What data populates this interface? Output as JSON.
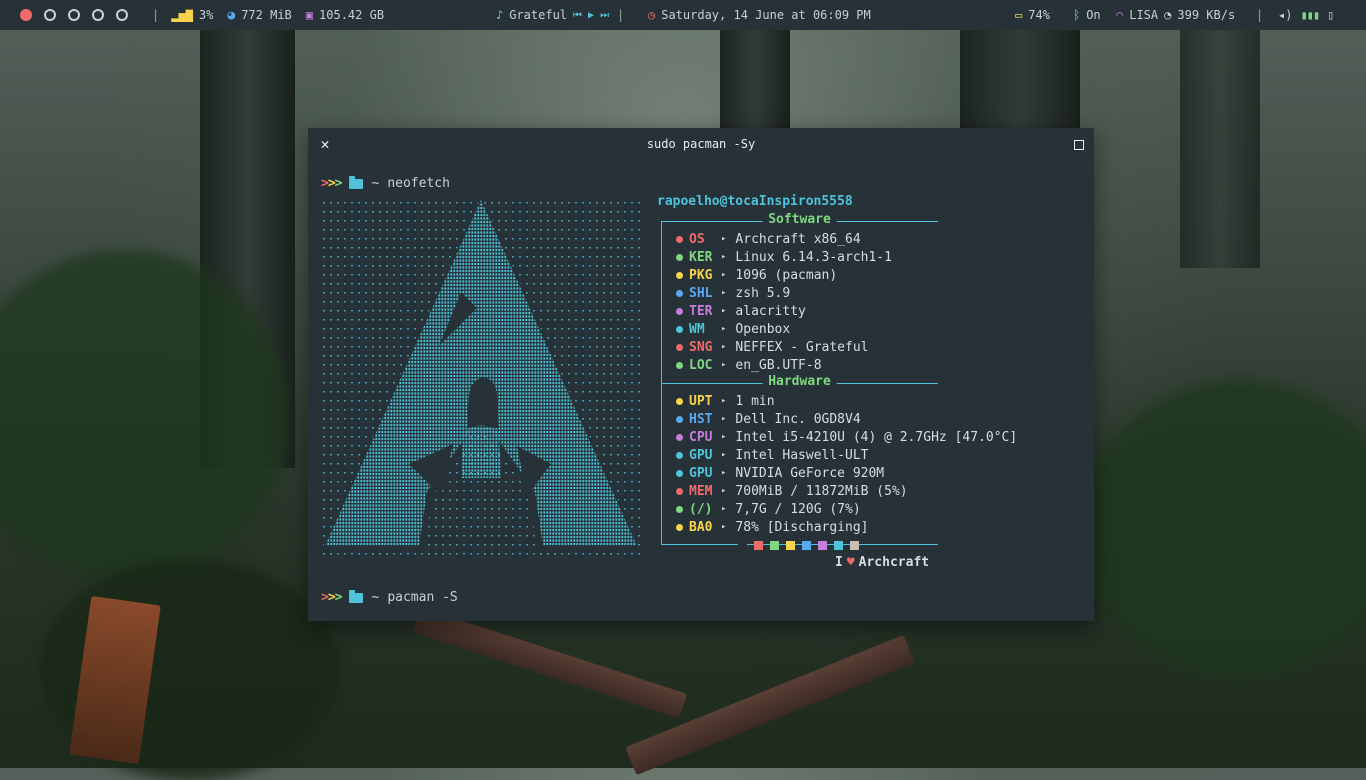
{
  "topbar": {
    "workspaces": [
      {
        "active": true
      },
      {
        "active": false
      },
      {
        "active": false
      },
      {
        "active": false
      },
      {
        "active": false
      }
    ],
    "cpu": "3%",
    "mem": "772 MiB",
    "disk": "105.42 GB",
    "song": "Grateful",
    "datetime": "Saturday, 14 June at 06:09 PM",
    "battery": "74%",
    "bluetooth": "On",
    "wifi_name": "LISA",
    "net_speed": "399 KB/s"
  },
  "terminal": {
    "title": "sudo pacman -Sy",
    "prompt1": {
      "arrows": ">>>",
      "cwd": "~",
      "command": "neofetch"
    },
    "prompt2": {
      "arrows": ">>>",
      "cwd": "~",
      "command": "pacman -S"
    },
    "user_host": "rapoelho@tocaInspiron5558",
    "software_title": "Software",
    "hardware_title": "Hardware",
    "software": [
      {
        "key": "OS",
        "value": "Archcraft x86_64",
        "color": "#ef6b6b"
      },
      {
        "key": "KER",
        "value": "Linux 6.14.3-arch1-1",
        "color": "#7fd87f"
      },
      {
        "key": "PKG",
        "value": "1096 (pacman)",
        "color": "#f7d44c"
      },
      {
        "key": "SHL",
        "value": "zsh 5.9",
        "color": "#5aa9f0"
      },
      {
        "key": "TER",
        "value": "alacritty",
        "color": "#c77ddb"
      },
      {
        "key": "WM",
        "value": "Openbox",
        "color": "#4fc3d9"
      },
      {
        "key": "SNG",
        "value": "NEFFEX - Grateful",
        "color": "#ef6b6b"
      },
      {
        "key": "LOC",
        "value": "en_GB.UTF-8",
        "color": "#7fd87f"
      }
    ],
    "hardware": [
      {
        "key": "UPT",
        "value": "1 min",
        "color": "#f7d44c"
      },
      {
        "key": "HST",
        "value": "Dell Inc. 0GD8V4",
        "color": "#5aa9f0"
      },
      {
        "key": "CPU",
        "value": "Intel i5-4210U (4) @ 2.7GHz [47.0°C]",
        "color": "#c77ddb"
      },
      {
        "key": "GPU",
        "value": "Intel Haswell-ULT",
        "color": "#4fc3d9"
      },
      {
        "key": "GPU",
        "value": "NVIDIA GeForce 920M",
        "color": "#4fc3d9"
      },
      {
        "key": "MEM",
        "value": "700MiB / 11872MiB (5%)",
        "color": "#ef6b6b"
      },
      {
        "key": "(/)",
        "value": "7,7G / 120G (7%)",
        "color": "#7fd87f"
      },
      {
        "key": "BA0",
        "value": "78% [Discharging]",
        "color": "#f7d44c"
      }
    ],
    "palette": [
      "#263238",
      "#ef6b6b",
      "#7fd87f",
      "#f7d44c",
      "#5aa9f0",
      "#c77ddb",
      "#4fc3d9",
      "#c8bfb0"
    ],
    "footer_prefix": "I",
    "footer_suffix": "Archcraft"
  },
  "colors": {
    "accent": "#4fc3d9",
    "red": "#ef6b6b",
    "green": "#7fd87f",
    "yellow": "#f7d44c",
    "blue": "#5aa9f0",
    "purple": "#c77ddb",
    "bar_bg": "#263238"
  }
}
